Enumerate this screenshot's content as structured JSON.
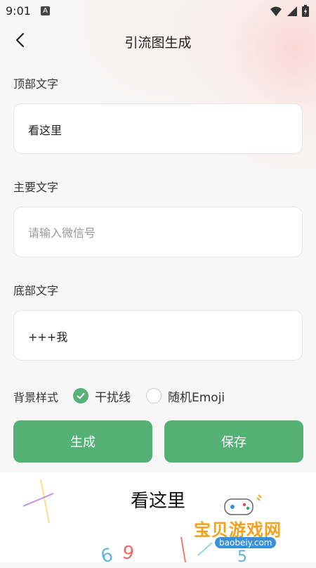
{
  "status_bar": {
    "time": "9:01",
    "notif_icon_letter": "A"
  },
  "header": {
    "title": "引流图生成"
  },
  "fields": {
    "top": {
      "label": "顶部文字",
      "value": "看这里",
      "placeholder": ""
    },
    "main": {
      "label": "主要文字",
      "value": "",
      "placeholder": "请输入微信号"
    },
    "bottom": {
      "label": "底部文字",
      "value": "+++我",
      "placeholder": ""
    }
  },
  "background_style": {
    "label": "背景样式",
    "options": [
      {
        "label": "干扰线",
        "selected": true
      },
      {
        "label": "随机Emoji",
        "selected": false
      }
    ]
  },
  "buttons": {
    "generate": "生成",
    "save": "保存"
  },
  "preview": {
    "top_text": "看这里",
    "noise_glyphs": [
      "6",
      "9",
      "5"
    ]
  },
  "watermark": {
    "main": "宝贝游戏网",
    "url": "baobeiy.com"
  },
  "colors": {
    "accent": "#55b076",
    "watermark": "#f2a21b",
    "watermark_url_bg": "#3b8fd6"
  }
}
